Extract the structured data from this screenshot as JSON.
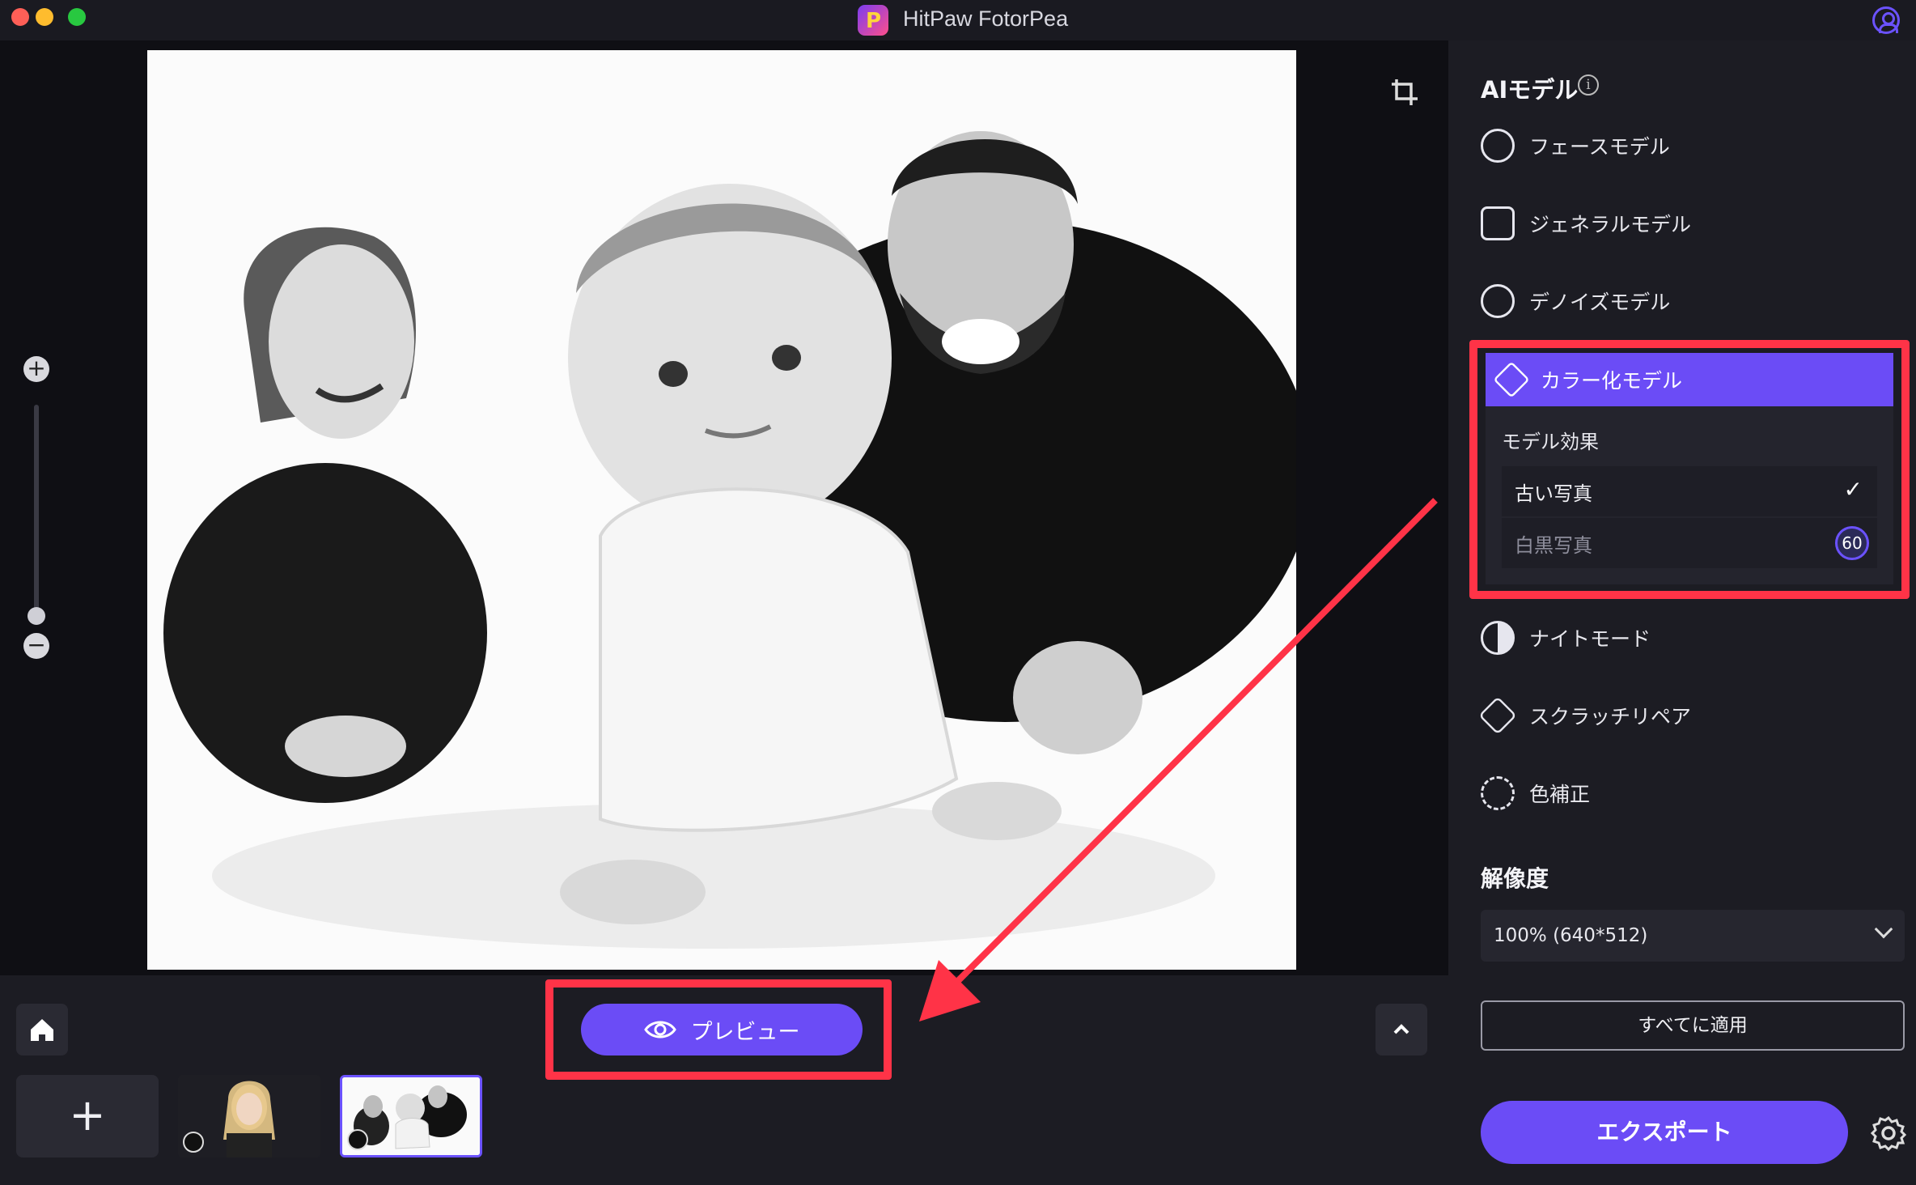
{
  "window": {
    "title": "HitPaw FotorPea"
  },
  "canvas": {
    "zoom_in": "+",
    "zoom_out": "−",
    "zoom_level": 0.08
  },
  "bottom": {
    "add_symbol": "+",
    "preview_label": "プレビュー"
  },
  "panel": {
    "title": "AIモデル",
    "info": "i",
    "models": [
      {
        "label": "フェースモデル",
        "icon": "face-icon"
      },
      {
        "label": "ジェネラルモデル",
        "icon": "image-icon"
      },
      {
        "label": "デノイズモデル",
        "icon": "denoise-icon"
      },
      {
        "label": "カラー化モデル",
        "icon": "colorize-icon",
        "selected": true
      },
      {
        "label": "ナイトモード",
        "icon": "half-circle-icon"
      },
      {
        "label": "スクラッチリペア",
        "icon": "scratch-icon"
      },
      {
        "label": "色補正",
        "icon": "color-adjust-icon"
      }
    ],
    "effect_label": "モデル効果",
    "effects": [
      {
        "label": "古い写真",
        "checked": true
      },
      {
        "label": "白黒写真",
        "value": "60"
      }
    ],
    "resolution_title": "解像度",
    "resolution_value": "100% (640*512)",
    "apply_all": "すべてに適用",
    "export": "エクスポート"
  },
  "colors": {
    "accent": "#6b4cf6",
    "highlight": "#ff3347",
    "background": "#121217"
  }
}
